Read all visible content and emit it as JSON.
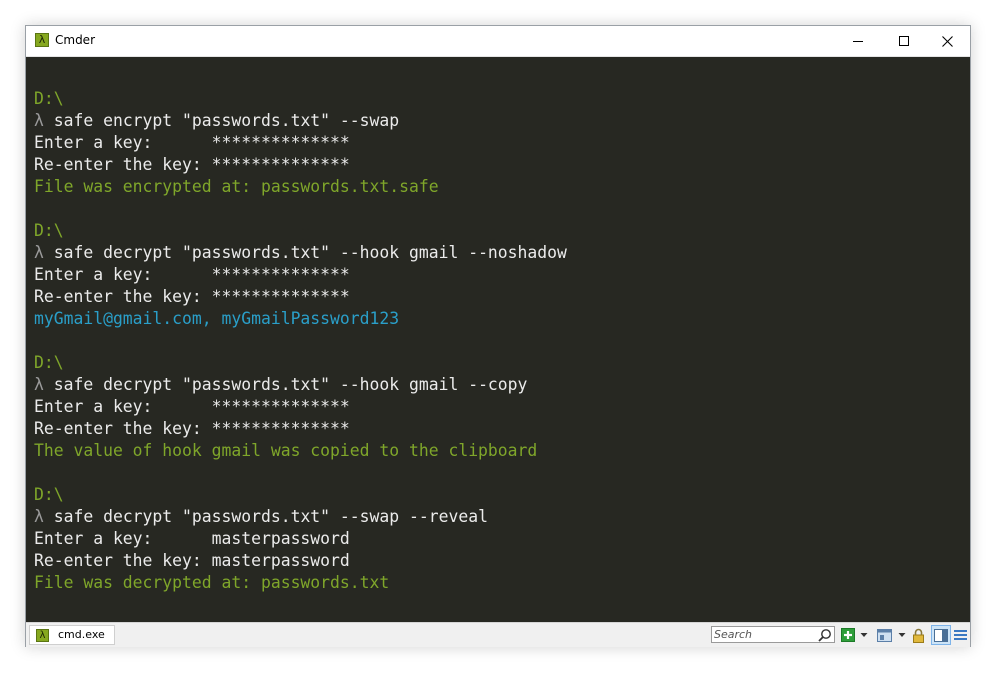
{
  "window": {
    "title": "Cmder",
    "app_icon_glyph": "λ"
  },
  "terminal": {
    "lines": [
      {
        "text": "D:\\",
        "color": "green"
      },
      {
        "prompt": "λ",
        "text": " safe encrypt \"passwords.txt\" --swap"
      },
      {
        "text": "Enter a key:      **************",
        "color": "white"
      },
      {
        "text": "Re-enter the key: **************",
        "color": "white"
      },
      {
        "text": "File was encrypted at: passwords.txt.safe",
        "color": "green"
      },
      {
        "text": "D:\\",
        "color": "green"
      },
      {
        "prompt": "λ",
        "text": " safe decrypt \"passwords.txt\" --hook gmail --noshadow"
      },
      {
        "text": "Enter a key:      **************",
        "color": "white"
      },
      {
        "text": "Re-enter the key: **************",
        "color": "white"
      },
      {
        "text": "myGmail@gmail.com, myGmailPassword123",
        "color": "blue"
      },
      {
        "text": "D:\\",
        "color": "green"
      },
      {
        "prompt": "λ",
        "text": " safe decrypt \"passwords.txt\" --hook gmail --copy"
      },
      {
        "text": "Enter a key:      **************",
        "color": "white"
      },
      {
        "text": "Re-enter the key: **************",
        "color": "white"
      },
      {
        "text": "The value of hook gmail was copied to the clipboard",
        "color": "green"
      },
      {
        "text": "D:\\",
        "color": "green"
      },
      {
        "prompt": "λ",
        "text": " safe decrypt \"passwords.txt\" --swap --reveal"
      },
      {
        "text": "Enter a key:      masterpassword",
        "color": "white"
      },
      {
        "text": "Re-enter the key: masterpassword",
        "color": "white"
      },
      {
        "text": "File was decrypted at: passwords.txt",
        "color": "green"
      }
    ]
  },
  "statusbar": {
    "tab_label": "cmd.exe",
    "tab_icon_glyph": "λ",
    "search_placeholder": "Search"
  },
  "colors": {
    "background": "#272822",
    "green": "#7fa62a",
    "white": "#ebebeb",
    "blue": "#2a9fc9",
    "prompt": "#9a9a9a",
    "accent": "#86a81f"
  },
  "icons": {
    "minimize": "minimize-icon",
    "maximize": "maximize-icon",
    "close": "close-icon",
    "search": "search-icon",
    "new_console": "plus-icon",
    "dropdown": "chevron-down-icon",
    "split": "window-icon",
    "lock": "lock-icon",
    "panel": "panel-icon",
    "menu": "hamburger-icon"
  }
}
